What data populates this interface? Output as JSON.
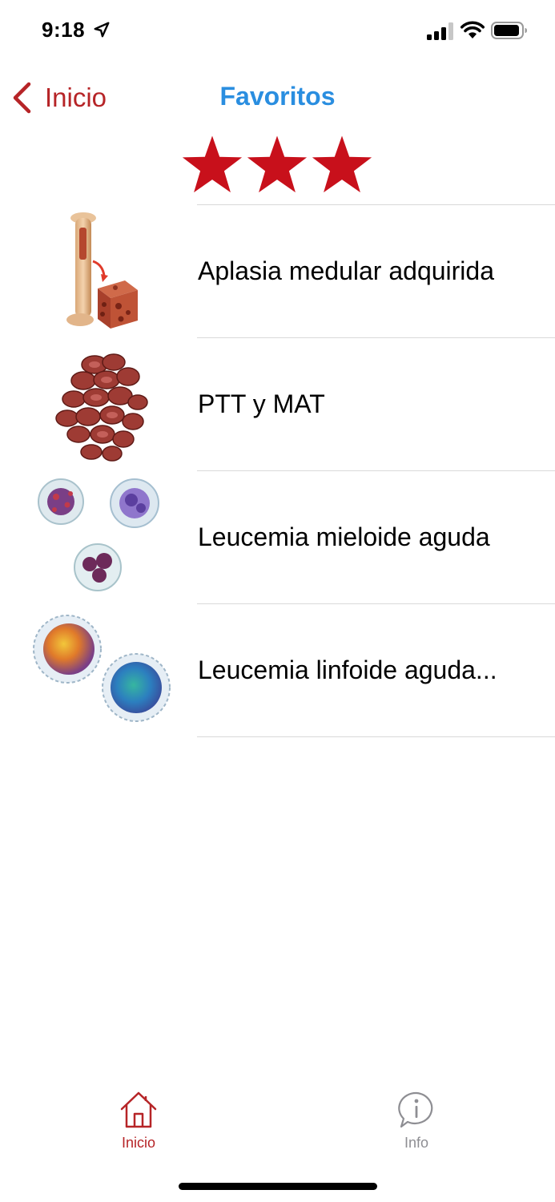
{
  "status_bar": {
    "time": "9:18"
  },
  "nav": {
    "back_label": "Inicio",
    "title": "Favoritos"
  },
  "rating": {
    "stars": 3,
    "star_color": "#c8101b"
  },
  "list": {
    "items": [
      {
        "label": "Aplasia medular adquirida",
        "thumb": "bone-marrow-image"
      },
      {
        "label": "PTT y MAT",
        "thumb": "red-cells-cluster-image"
      },
      {
        "label": "Leucemia mieloide aguda",
        "thumb": "myeloid-cells-image"
      },
      {
        "label": "Leucemia linfoide aguda...",
        "thumb": "lymphoid-cells-image"
      }
    ]
  },
  "tab_bar": {
    "tabs": [
      {
        "label": "Inicio",
        "icon": "home-icon",
        "selected": true
      },
      {
        "label": "Info",
        "icon": "info-bubble-icon",
        "selected": false
      }
    ]
  },
  "colors": {
    "accent_red": "#b62427",
    "title_blue": "#2a8ee0",
    "inactive_gray": "#8e8e93"
  }
}
